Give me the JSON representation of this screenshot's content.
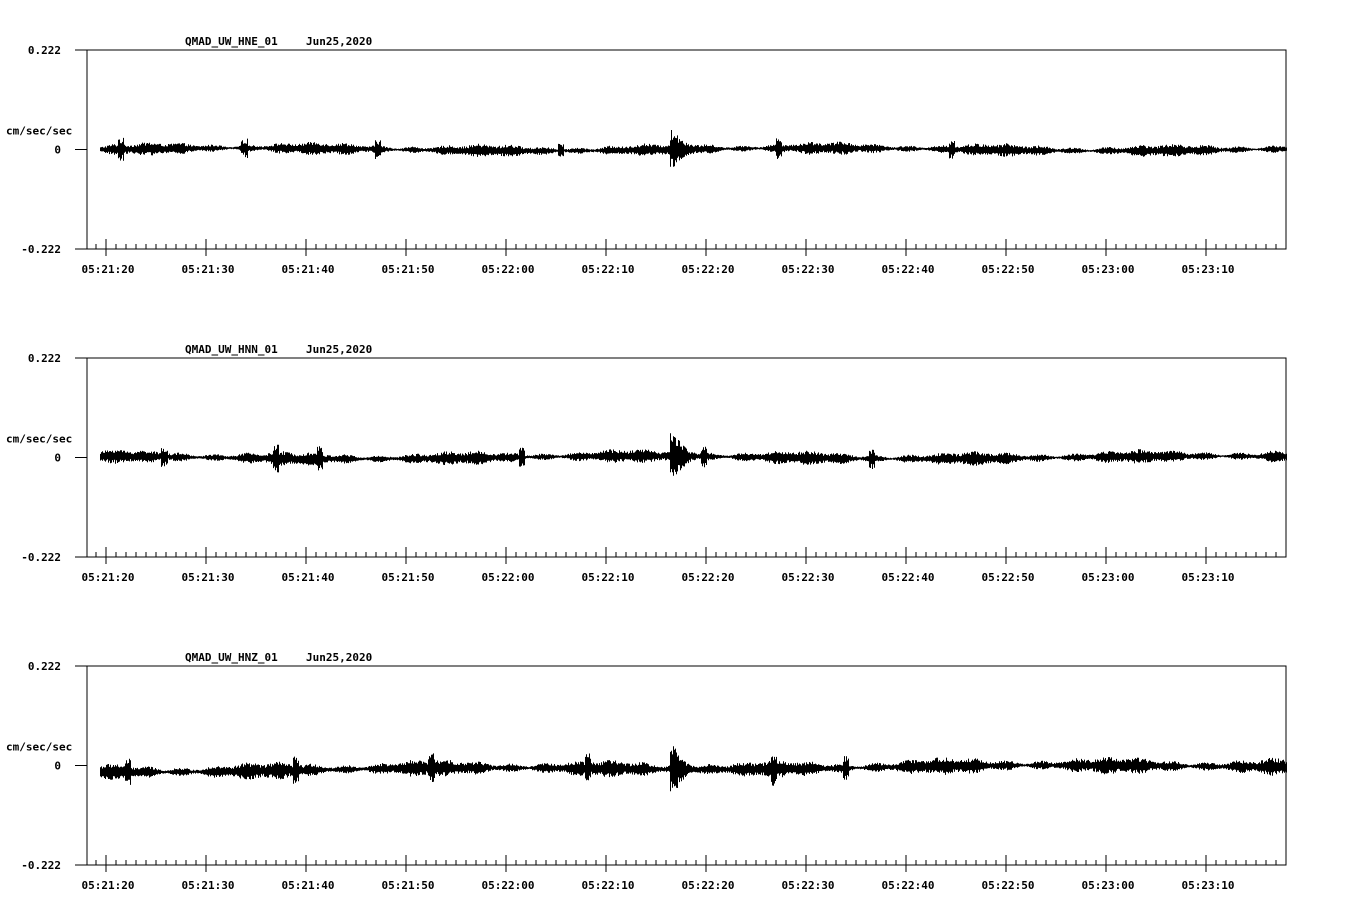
{
  "chart_data": [
    {
      "type": "line",
      "title": "QMAD_UW_HNE_01",
      "date": "Jun25,2020",
      "ylabel": "cm/sec/sec",
      "ytick_labels": [
        "0.222",
        "0",
        "-0.222"
      ],
      "ylim": [
        -0.222,
        0.222
      ],
      "xtick_labels": [
        "05:21:20",
        "05:21:30",
        "05:21:40",
        "05:21:50",
        "05:22:00",
        "05:22:10",
        "05:22:20",
        "05:22:30",
        "05:22:40",
        "05:22:50",
        "05:23:00",
        "05:23:10"
      ],
      "xlim_seconds": [
        -1.9,
        118.0
      ],
      "waveform": {
        "start": -0.6,
        "end": 118.0,
        "offset": 0.0,
        "amplitude": 0.012,
        "event_time": 56.7,
        "event_amplitude": 0.03,
        "spike_times": [
          1.5,
          13.8,
          27.2,
          45.5,
          67.3,
          84.6
        ]
      }
    },
    {
      "type": "line",
      "title": "QMAD_UW_HNN_01",
      "date": "Jun25,2020",
      "ylabel": "cm/sec/sec",
      "ytick_labels": [
        "0.222",
        "0",
        "-0.222"
      ],
      "ylim": [
        -0.222,
        0.222
      ],
      "xtick_labels": [
        "05:21:20",
        "05:21:30",
        "05:21:40",
        "05:21:50",
        "05:22:00",
        "05:22:10",
        "05:22:20",
        "05:22:30",
        "05:22:40",
        "05:22:50",
        "05:23:00",
        "05:23:10"
      ],
      "xlim_seconds": [
        -1.9,
        118.0
      ],
      "waveform": {
        "start": -0.6,
        "end": 118.0,
        "offset": 0.0,
        "amplitude": 0.013,
        "event_time": 56.7,
        "event_amplitude": 0.05,
        "spike_times": [
          5.8,
          17.0,
          21.4,
          41.6,
          59.8,
          76.5
        ]
      }
    },
    {
      "type": "line",
      "title": "QMAD_UW_HNZ_01",
      "date": "Jun25,2020",
      "ylabel": "cm/sec/sec",
      "ytick_labels": [
        "0.222",
        "0",
        "-0.222"
      ],
      "ylim": [
        -0.222,
        0.222
      ],
      "xtick_labels": [
        "05:21:20",
        "05:21:30",
        "05:21:40",
        "05:21:50",
        "05:22:00",
        "05:22:10",
        "05:22:20",
        "05:22:30",
        "05:22:40",
        "05:22:50",
        "05:23:00",
        "05:23:10"
      ],
      "xlim_seconds": [
        -1.9,
        118.0
      ],
      "waveform": {
        "start": -0.6,
        "end": 118.0,
        "offset": -0.012,
        "amplitude": 0.016,
        "event_time": 56.7,
        "event_amplitude": 0.05,
        "spike_times": [
          2.2,
          19.0,
          32.5,
          48.2,
          66.8,
          73.9
        ]
      }
    }
  ]
}
